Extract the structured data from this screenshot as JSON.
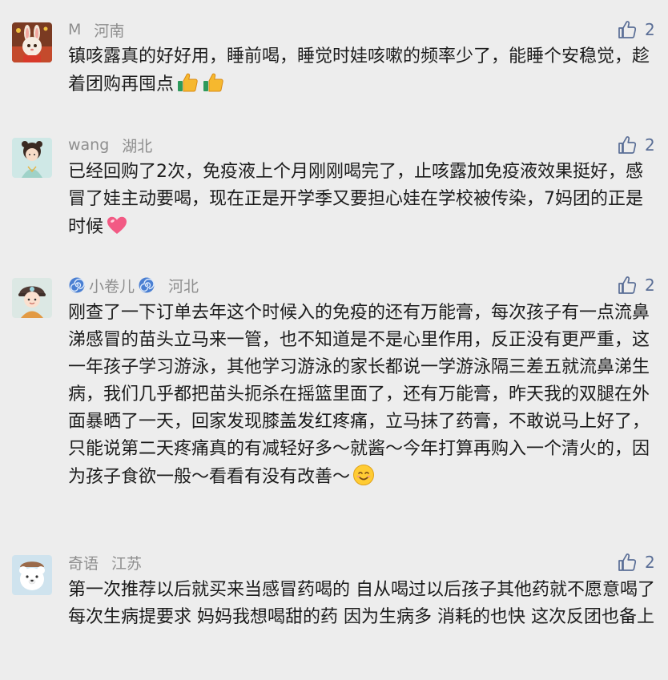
{
  "comments": [
    {
      "username": "M",
      "location": "河南",
      "likes": "2",
      "avatar_icon": "rabbit-avatar-icon",
      "text": "镇咳露真的好好用，睡前喝，睡觉时娃咳嗽的频率少了，能睡个安稳觉，趁着团购再囤点",
      "emojis": [
        "thumbs-up-icon",
        "thumbs-up-icon"
      ]
    },
    {
      "username": "wang",
      "location": "湖北",
      "likes": "2",
      "avatar_icon": "girl-avatar-icon",
      "text": "已经回购了2次，免疫液上个月刚刚喝完了，止咳露加免疫液效果挺好，感冒了娃主动要喝，现在正是开学季又要担心娃在学校被传染，7妈团的正是时候",
      "emojis": [
        "heart-icon"
      ]
    },
    {
      "username": "小卷儿",
      "location": "河北",
      "likes": "2",
      "avatar_icon": "cartoon-boy-avatar-icon",
      "name_decoration": "swirl-icon",
      "text": "刚查了一下订单去年这个时候入的免疫的还有万能膏，每次孩子有一点流鼻涕感冒的苗头立马来一管，也不知道是不是心里作用，反正没有更严重，这一年孩子学习游泳，其他学习游泳的家长都说一学游泳隔三差五就流鼻涕生病，我们几乎都把苗头扼杀在摇篮里面了，还有万能膏，昨天我的双腿在外面暴晒了一天，回家发现膝盖发红疼痛，立马抹了药膏，不敢说马上好了，只能说第二天疼痛真的有减轻好多～就酱～今年打算再购入一个清火的，因为孩子食欲一般～看看有没有改善～",
      "emojis": [
        "smile-icon"
      ]
    },
    {
      "username": "奇语",
      "location": "江苏",
      "likes": "2",
      "avatar_icon": "polar-bear-avatar-icon",
      "text": "第一次推荐以后就买来当感冒药喝的 自从喝过以后孩子其他药就不愿意喝了 每次生病提要求 妈妈我想喝甜的药 因为生病多 消耗的也快 这次反团也备上",
      "emojis": []
    }
  ],
  "colors": {
    "background": "#ededed",
    "meta_text": "#8e8e8e",
    "like_blue": "#5a6e96",
    "body_text": "#1c1c1c"
  }
}
